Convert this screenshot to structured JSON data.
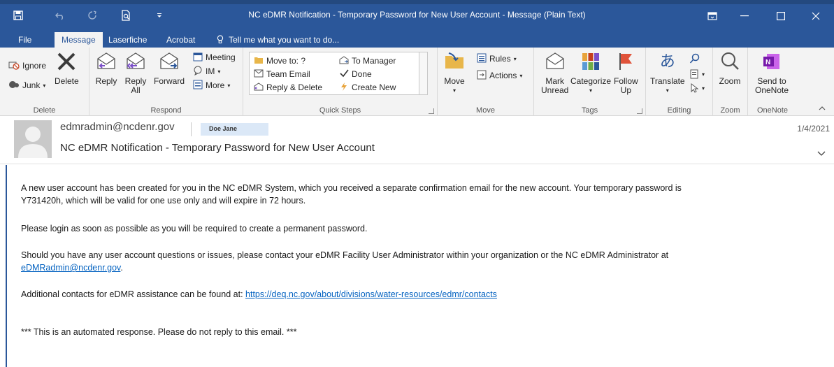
{
  "window": {
    "title": "NC eDMR Notification - Temporary Password for New User Account  -  Message (Plain Text)"
  },
  "tabs": {
    "file": "File",
    "message": "Message",
    "laserfiche": "Laserfiche",
    "acrobat": "Acrobat",
    "tell_me": "Tell me what you want to do..."
  },
  "ribbon": {
    "delete_group": {
      "ignore": "Ignore",
      "junk": "Junk",
      "delete": "Delete",
      "label": "Delete"
    },
    "respond_group": {
      "reply": "Reply",
      "reply_all_1": "Reply",
      "reply_all_2": "All",
      "forward": "Forward",
      "meeting": "Meeting",
      "im": "IM",
      "more": "More",
      "label": "Respond"
    },
    "quick_steps": {
      "move_to": "Move to: ?",
      "team_email": "Team Email",
      "reply_delete": "Reply & Delete",
      "to_manager": "To Manager",
      "done": "Done",
      "create_new": "Create New",
      "label": "Quick Steps"
    },
    "move_group": {
      "move": "Move",
      "rules": "Rules",
      "actions": "Actions",
      "label": "Move"
    },
    "tags_group": {
      "mark_unread_1": "Mark",
      "mark_unread_2": "Unread",
      "categorize": "Categorize",
      "follow_up_1": "Follow",
      "follow_up_2": "Up",
      "label": "Tags"
    },
    "editing_group": {
      "translate": "Translate",
      "label": "Editing"
    },
    "zoom_group": {
      "zoom": "Zoom",
      "label": "Zoom"
    },
    "onenote_group": {
      "send_1": "Send to",
      "send_2": "OneNote",
      "label": "OneNote"
    }
  },
  "message": {
    "sender": "edmradmin@ncdenr.gov",
    "to": "Doe Jane",
    "date": "1/4/2021",
    "subject": "NC eDMR Notification - Temporary Password for New User Account"
  },
  "body": {
    "p1_line1": "A new user account has been created for you in the NC eDMR System, which you received a separate confirmation email for the new account.    Your temporary password is",
    "p1_line2": "Y731420h, which will be valid for one use only and will expire in 72 hours.",
    "p2": "Please login as soon as possible as you will be required to create a permanent password.",
    "p3_line1": "Should you have any user account questions or issues, please contact your eDMR Facility User Administrator within your organization or the NC eDMR Administrator at",
    "p3_link": "eDMRadmin@ncdenr.gov",
    "p3_end": ".",
    "p4_text": "Additional contacts for eDMR assistance can be found at:  ",
    "p4_link": "https://deq.nc.gov/about/divisions/water-resources/edmr/contacts",
    "p5": "*** This is an automated response. Please do not reply to this email. ***"
  },
  "colors": {
    "accent": "#2b579a",
    "link": "#0563c1",
    "to_chip": "#dbe8f7"
  }
}
